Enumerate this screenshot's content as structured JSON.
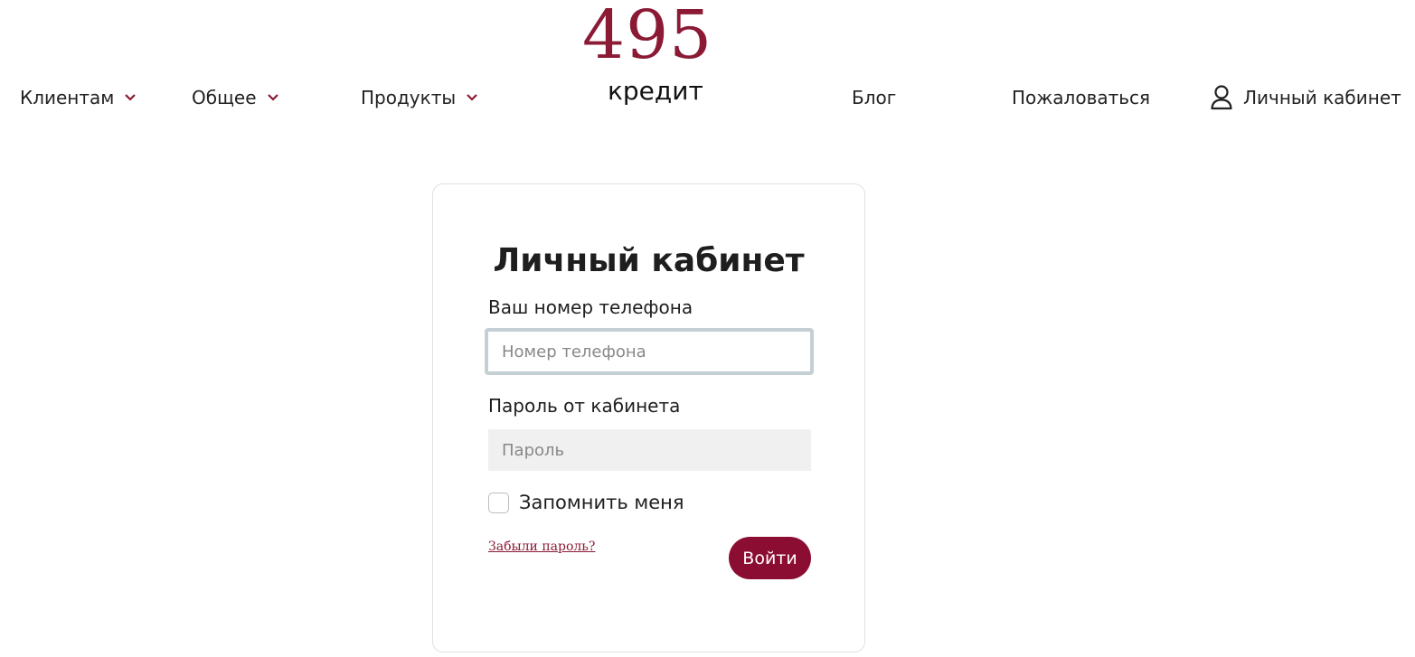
{
  "header": {
    "nav_left": [
      {
        "label": "Клиентам"
      },
      {
        "label": "Общее"
      },
      {
        "label": "Продукты"
      }
    ],
    "logo": {
      "number": "495",
      "subtitle": "кредит"
    },
    "nav_right": {
      "blog": "Блог",
      "complain": "Пожаловаться",
      "cabinet": "Личный кабинет"
    }
  },
  "login": {
    "title": "Личный кабинет",
    "phone_label": "Ваш номер телефона",
    "phone_placeholder": "Номер телефона",
    "password_label": "Пароль от кабинета",
    "password_placeholder": "Пароль",
    "remember_label": "Запомнить меня",
    "forgot_label": "Забыли пароль?",
    "submit_label": "Войти"
  },
  "colors": {
    "brand": "#8b1a35",
    "button": "#8b0d31",
    "input_focus_border": "#c3cfd3",
    "input_bg": "#f0f0f0"
  },
  "icons": {
    "dropdown": "chevron-down-icon",
    "user": "user-icon"
  }
}
